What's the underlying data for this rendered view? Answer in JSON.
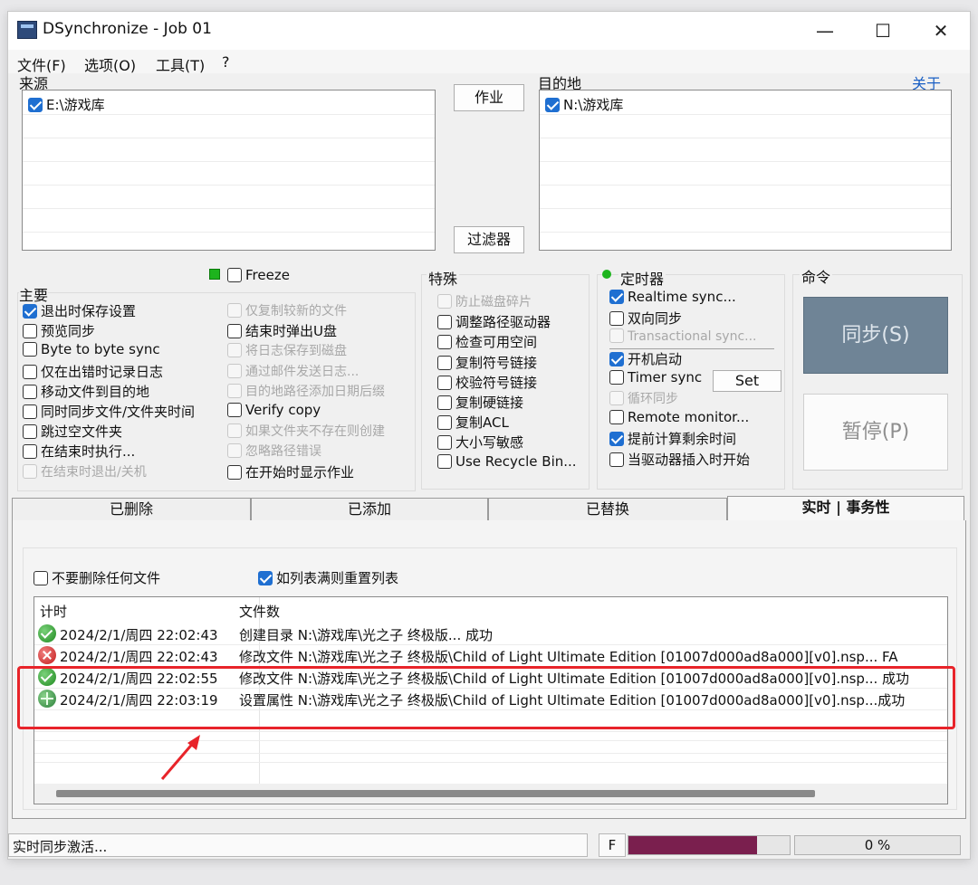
{
  "window": {
    "title": "DSynchronize - Job 01",
    "controls": {
      "minimize": "—",
      "maximize": "☐",
      "close": "✕"
    }
  },
  "menu": [
    "文件(F)",
    "选项(O)",
    "工具(T)",
    "?"
  ],
  "source": {
    "label": "来源",
    "items": [
      {
        "path": "E:\\游戏库",
        "checked": true
      }
    ]
  },
  "destination": {
    "label": "目的地",
    "about_link": "关于",
    "items": [
      {
        "path": "N:\\游戏库",
        "checked": true
      }
    ]
  },
  "center_buttons": {
    "job": "作业",
    "filter": "过滤器"
  },
  "freeze": {
    "label": "Freeze",
    "indicator_color": "#1db41d"
  },
  "main_options": {
    "label": "主要",
    "left": [
      {
        "label": "退出时保存设置",
        "checked": true,
        "enabled": true
      },
      {
        "label": "预览同步",
        "checked": false,
        "enabled": true
      },
      {
        "label": "Byte to byte sync",
        "checked": false,
        "enabled": true
      },
      {
        "label": "仅在出错时记录日志",
        "checked": false,
        "enabled": true
      },
      {
        "label": "移动文件到目的地",
        "checked": false,
        "enabled": true
      },
      {
        "label": "同时同步文件/文件夹时间",
        "checked": false,
        "enabled": true
      },
      {
        "label": "跳过空文件夹",
        "checked": false,
        "enabled": true
      },
      {
        "label": "在结束时执行...",
        "checked": false,
        "enabled": true
      },
      {
        "label": "在结束时退出/关机",
        "checked": false,
        "enabled": false
      }
    ],
    "right": [
      {
        "label": "仅复制较新的文件",
        "checked": false,
        "enabled": false
      },
      {
        "label": "结束时弹出U盘",
        "checked": false,
        "enabled": true
      },
      {
        "label": "将日志保存到磁盘",
        "checked": false,
        "enabled": false
      },
      {
        "label": "通过邮件发送日志...",
        "checked": false,
        "enabled": false
      },
      {
        "label": "目的地路径添加日期后缀",
        "checked": false,
        "enabled": false
      },
      {
        "label": "Verify copy",
        "checked": false,
        "enabled": true
      },
      {
        "label": "如果文件夹不存在则创建",
        "checked": false,
        "enabled": false
      },
      {
        "label": "忽略路径错误",
        "checked": false,
        "enabled": false
      },
      {
        "label": "在开始时显示作业",
        "checked": false,
        "enabled": true
      }
    ]
  },
  "special": {
    "label": "特殊",
    "items": [
      {
        "label": "防止磁盘碎片",
        "checked": false,
        "enabled": false
      },
      {
        "label": "调整路径驱动器",
        "checked": false,
        "enabled": true
      },
      {
        "label": "检查可用空间",
        "checked": false,
        "enabled": true
      },
      {
        "label": "复制符号链接",
        "checked": false,
        "enabled": true
      },
      {
        "label": "校验符号链接",
        "checked": false,
        "enabled": true
      },
      {
        "label": "复制硬链接",
        "checked": false,
        "enabled": true
      },
      {
        "label": "复制ACL",
        "checked": false,
        "enabled": true
      },
      {
        "label": "大小写敏感",
        "checked": false,
        "enabled": true
      },
      {
        "label": "Use Recycle Bin...",
        "checked": false,
        "enabled": true
      }
    ]
  },
  "timer": {
    "label": "定时器",
    "indicator_color": "#1db41d",
    "items": [
      {
        "label": "Realtime sync...",
        "checked": true,
        "enabled": true
      },
      {
        "label": "双向同步",
        "checked": false,
        "enabled": true
      },
      {
        "label": "Transactional sync...",
        "checked": false,
        "enabled": false
      },
      {
        "label": "开机启动",
        "checked": true,
        "enabled": true
      },
      {
        "label": "Timer sync",
        "checked": false,
        "enabled": true
      },
      {
        "label": "循环同步",
        "checked": false,
        "enabled": false
      },
      {
        "label": "Remote monitor...",
        "checked": false,
        "enabled": true
      },
      {
        "label": "提前计算剩余时间",
        "checked": true,
        "enabled": true
      },
      {
        "label": "当驱动器插入时开始",
        "checked": false,
        "enabled": true
      }
    ],
    "set_button": "Set"
  },
  "commands": {
    "label": "命令",
    "sync_button": "同步(S)",
    "pause_button": "暂停(P)",
    "sync_color": "#6f8496"
  },
  "tabs": [
    "已删除",
    "已添加",
    "已替换",
    "实时 | 事务性"
  ],
  "active_tab": 3,
  "realtime_panel": {
    "no_delete": {
      "label": "不要删除任何文件",
      "checked": false
    },
    "reset_list": {
      "label": "如列表满则重置列表",
      "checked": true
    }
  },
  "log": {
    "columns": [
      "计时",
      "文件数"
    ],
    "rows": [
      {
        "status": "ok",
        "time": "2024/2/1/周四 22:02:43",
        "message": "创建目录 N:\\游戏库\\光之子 终极版... 成功"
      },
      {
        "status": "error",
        "time": "2024/2/1/周四 22:02:43",
        "message": "修改文件 N:\\游戏库\\光之子 终极版\\Child of Light Ultimate Edition [01007d000ad8a000][v0].nsp... FA"
      },
      {
        "status": "ok",
        "time": "2024/2/1/周四 22:02:55",
        "message": "修改文件 N:\\游戏库\\光之子 终极版\\Child of Light Ultimate Edition [01007d000ad8a000][v0].nsp... 成功"
      },
      {
        "status": "attr",
        "time": "2024/2/1/周四 22:03:19",
        "message": "设置属性 N:\\游戏库\\光之子 终极版\\Child of Light Ultimate Edition [01007d000ad8a000][v0].nsp...成功"
      }
    ]
  },
  "statusbar": {
    "text": "实时同步激活...",
    "flag": "F",
    "progress_fraction": 0.8,
    "percent": "0 %",
    "progress_color": "#7a1f4e"
  },
  "annotation": {
    "highlight_color": "#e8242a"
  }
}
